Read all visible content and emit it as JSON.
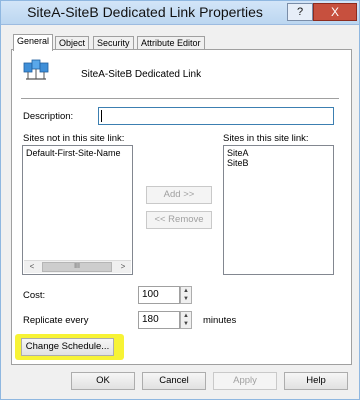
{
  "window": {
    "title": "SiteA-SiteB Dedicated Link Properties",
    "help_label": "?",
    "close_label": "X"
  },
  "tabs": [
    {
      "label": "General",
      "active": true
    },
    {
      "label": "Object",
      "active": false
    },
    {
      "label": "Security",
      "active": false
    },
    {
      "label": "Attribute Editor",
      "active": false
    }
  ],
  "general": {
    "icon": "site-link-icon",
    "name": "SiteA-SiteB Dedicated Link",
    "description_label": "Description:",
    "description_value": "",
    "sites_not_label": "Sites not in this site link:",
    "sites_not_items": [
      "Default-First-Site-Name"
    ],
    "sites_in_label": "Sites in this site link:",
    "sites_in_items": [
      "SiteA",
      "SiteB"
    ],
    "add_button": "Add >>",
    "remove_button": "<< Remove",
    "scroll_left": "<",
    "scroll_thumb": "III",
    "scroll_right": ">",
    "cost_label": "Cost:",
    "cost_value": "100",
    "replicate_label": "Replicate every",
    "replicate_value": "180",
    "replicate_units": "minutes",
    "change_schedule_button": "Change Schedule...",
    "spin_up": "▲",
    "spin_down": "▼"
  },
  "footer": {
    "ok": "OK",
    "cancel": "Cancel",
    "apply": "Apply",
    "help": "Help"
  },
  "colors": {
    "highlight": "#f7f335",
    "close_button": "#c7503e",
    "focus_border": "#3c7fb1"
  }
}
